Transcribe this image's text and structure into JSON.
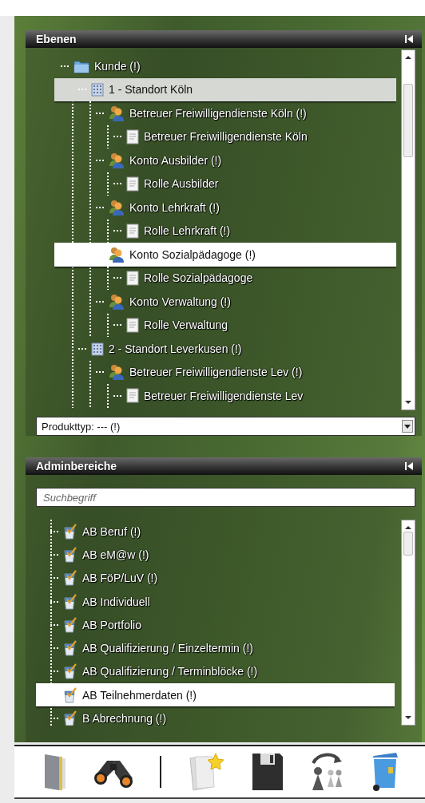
{
  "layers_panel": {
    "title": "Ebenen",
    "tree": [
      {
        "label": "Kunde (!)",
        "kind": "folder",
        "selected": false,
        "marked": false,
        "children": [
          {
            "label": "1 - Standort Köln",
            "kind": "site",
            "selected": false,
            "marked": true,
            "children": [
              {
                "label": "Betreuer Freiwilligendienste Köln (!)",
                "kind": "account",
                "selected": false,
                "marked": false,
                "children": [
                  {
                    "label": "Betreuer Freiwilligendienste Köln",
                    "kind": "role",
                    "selected": false,
                    "marked": false
                  }
                ]
              },
              {
                "label": "Konto Ausbilder (!)",
                "kind": "account",
                "selected": false,
                "marked": false,
                "children": [
                  {
                    "label": "Rolle Ausbilder",
                    "kind": "role",
                    "selected": false,
                    "marked": false
                  }
                ]
              },
              {
                "label": "Konto Lehrkraft (!)",
                "kind": "account",
                "selected": false,
                "marked": false,
                "children": [
                  {
                    "label": "Rolle Lehrkraft (!)",
                    "kind": "role",
                    "selected": false,
                    "marked": false
                  }
                ]
              },
              {
                "label": "Konto Sozialpädagoge (!)",
                "kind": "account",
                "selected": true,
                "marked": false,
                "children": [
                  {
                    "label": "Rolle Sozialpädagoge",
                    "kind": "role",
                    "selected": false,
                    "marked": false
                  }
                ]
              },
              {
                "label": "Konto Verwaltung (!)",
                "kind": "account",
                "selected": false,
                "marked": false,
                "children": [
                  {
                    "label": "Rolle Verwaltung",
                    "kind": "role",
                    "selected": false,
                    "marked": false
                  }
                ]
              }
            ]
          },
          {
            "label": "2 - Standort Leverkusen (!)",
            "kind": "site",
            "selected": false,
            "marked": false,
            "children": [
              {
                "label": "Betreuer Freiwilligendienste Lev (!)",
                "kind": "account",
                "selected": false,
                "marked": false,
                "children": [
                  {
                    "label": "Betreuer Freiwilligendienste Lev",
                    "kind": "role",
                    "selected": false,
                    "marked": false
                  }
                ]
              }
            ]
          }
        ]
      }
    ],
    "product_type": {
      "value": "Produkttyp: --- (!)"
    }
  },
  "admin_panel": {
    "title": "Adminbereiche",
    "search": {
      "placeholder": "Suchbegriff"
    },
    "items": [
      {
        "label": "AB Beruf (!)",
        "selected": false
      },
      {
        "label": "AB eM@w (!)",
        "selected": false
      },
      {
        "label": "AB FöP/LuV (!)",
        "selected": false
      },
      {
        "label": "AB Individuell",
        "selected": false
      },
      {
        "label": "AB Portfolio",
        "selected": false
      },
      {
        "label": "AB Qualifizierung / Einzeltermin (!)",
        "selected": false
      },
      {
        "label": "AB Qualifizierung / Terminblöcke (!)",
        "selected": false
      },
      {
        "label": "AB Teilnehmerdaten (!)",
        "selected": true
      },
      {
        "label": "B Abrechnung (!)",
        "selected": false
      }
    ]
  }
}
